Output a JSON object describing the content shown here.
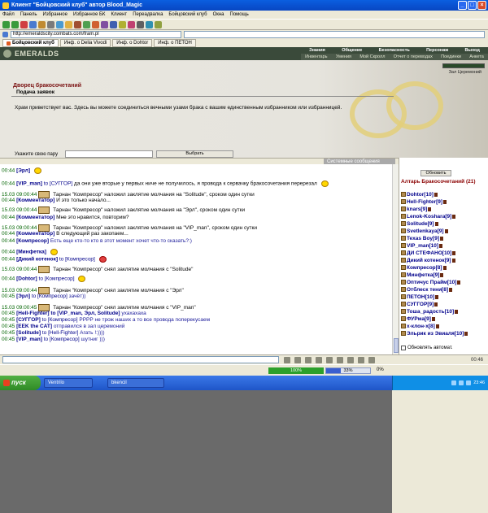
{
  "window": {
    "title": "Клиент \"Бойцовский клуб\" автор Blood_Magic"
  },
  "menu": [
    "Файл",
    "Панель",
    "Избранное",
    "Избранное БК",
    "Клиент",
    "Переадвалка",
    "Бойцовский клуб",
    "Окна",
    "Помощь"
  ],
  "address": {
    "value": "http://emeraldscity.combats.com/fram.pl"
  },
  "tabs": [
    {
      "label": "Бойцовский клуб",
      "active": true
    },
    {
      "label": "Инф. о Delia Vivodi",
      "active": false
    },
    {
      "label": "Инф. о Dohtor",
      "active": false
    },
    {
      "label": "Инф. о ПЕТОН",
      "active": false
    }
  ],
  "header": {
    "logo": "EMERALDS",
    "nav": [
      "Знания",
      "Общение",
      "Безопасность",
      "Персонаж",
      "Выход"
    ],
    "nav2": [
      "Инвентарь",
      "Умения",
      "Мой Скролл",
      "Отчет о переводах",
      "Поединки",
      "Анкета"
    ]
  },
  "palace": {
    "title": "Дворец бракосочетаний",
    "room": "Зал Церемоний",
    "panel_title": "Подача заявок",
    "text": "Храм приветствует вас. Здесь вы можете соединиться вечными узами брака с вашим единственным избранником или избранницей.",
    "label": "Укажите свою пару",
    "button": "Выбрать"
  },
  "chat_tabs": {
    "chat": "Чат",
    "system": "Системные сообщения"
  },
  "chat": [
    {
      "time": "00:44",
      "nick": "[Эрл]",
      "msg": ""
    },
    {
      "time": "00:44",
      "nick": "[VIP_man]",
      "to": "to [СУГГОР]",
      "msg": " да они уже вторые у первых ниче не получилось, я провода к сервачку бракосочетания перерезал"
    },
    {
      "time": "15.03 09:00:44",
      "msg": " Тарнан \"Компресор\" наложил заклятие молчания на \"Solitude\", сроком один сутки"
    },
    {
      "time": "00:44",
      "nick": "[Комментатор]",
      "msg": " И это только начало..."
    },
    {
      "time": "15.03 09:00:44",
      "msg": " Тарнан \"Компресор\" наложил заклятие молчания на \"Эрл\", сроком один сутки"
    },
    {
      "time": "00:44",
      "nick": "[Комментатор]",
      "msg": " Мне это нравится, повторим?"
    },
    {
      "time": "15.03 09:00:44",
      "msg": " Тарнан \"Компресор\" наложил заклятие молчания на \"VIP_man\", сроком один сутки"
    },
    {
      "time": "00:44",
      "nick": "[Комментатор]",
      "msg": " В следующий раз закопаем..."
    },
    {
      "time": "00:44",
      "nick": "[Компресор]",
      "msg": " Есть еще кто-то кто в этот момент хочет что-то сказать?:)"
    },
    {
      "time": "00:44",
      "nick": "[Минфетка]",
      "msg": ""
    },
    {
      "time": "00:44",
      "nick": "[Дикий котенок]",
      "to": "to [Компресор]",
      "msg": ""
    },
    {
      "time": "15.03 09:00:44",
      "msg": " Тарнан \"Компресор\" снял заклятие молчания с \"Solitude\""
    },
    {
      "time": "00:44",
      "nick": "[Dohtor]",
      "to": "to [Компресор]",
      "msg": ""
    },
    {
      "time": "15.03 09:00:44",
      "msg": " Тарнан \"Компресор\" снял заклятие молчания с \"Эрл\""
    },
    {
      "time": "00:45",
      "nick": "[Эрл]",
      "to": "to [Компресор]",
      "msg": " зачёт))"
    },
    {
      "time": "15.03 09:00:45",
      "msg": " Тарнан \"Компресор\" снял заклятие молчания с \"VIP_man\""
    },
    {
      "time": "00:45",
      "nick": "[Hell-Fighter]",
      "to": "to [VIP_man, Эрл, Solitude]",
      "msg": " ухахахаха"
    },
    {
      "time": "00:45",
      "nick": "[СУГГОР]",
      "to": "to [Компресор]",
      "msg": " РРРР не трож наших а то все провода поперекусаем"
    },
    {
      "time": "00:45",
      "nick": "[EEK the CAT]",
      "msg": " отправился в зал церемоний"
    },
    {
      "time": "00:45",
      "nick": "[Solitude]",
      "to": "to [Hell-Fighter]",
      "msg": " Агать !:))))"
    },
    {
      "time": "00:45",
      "nick": "[VIP_man]",
      "to": "to [Компресор]",
      "msg": " шутниг )))"
    }
  ],
  "sidebar": {
    "refresh": "Обновить",
    "title": "Алтарь Бракосочетаний (21)",
    "users": [
      "Dohtor[10]",
      "Hell-Fighter[9]",
      "knars[9]",
      "Lenok-Koshara[9]",
      "Solitude[9]",
      "Svetlenkaya[9]",
      "Texas Boy[9]",
      "VIP_man[10]",
      "ДИ СТЕФАНО[10]",
      "Дикий котенок[9]",
      "Компресор[8]",
      "Минфетка[9]",
      "Оптичус Прайм[10]",
      "Отблеск тени[8]",
      "ПЕТОН[10]",
      "СУГГОР[9]",
      "Тоша_радость[10]",
      "ФУРма[9]",
      "х-клон-х[8]",
      "Эльрик из Эвиаля[10]",
      "Эрл[9]"
    ],
    "auto_refresh": "Обновлять автомат."
  },
  "clock": "00:46",
  "status": {
    "green": "100%",
    "blue": "33%",
    "blue_fraction": 0.33,
    "pct": "0%"
  },
  "taskbar": {
    "start": "пуск",
    "tasks": [
      "Ventrilo",
      "bkencil",
      "Клиент \"Бойцовский клуб\""
    ],
    "time": "23:46"
  }
}
